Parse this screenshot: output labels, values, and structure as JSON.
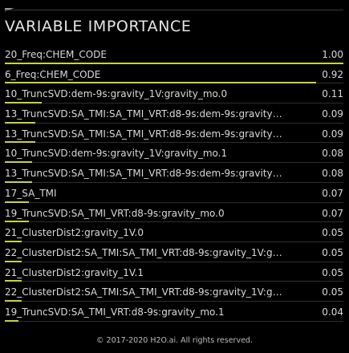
{
  "title": "VARIABLE IMPORTANCE",
  "footer": "© 2017-2020 H2O.ai. All rights reserved.",
  "colors": {
    "background": "#000000",
    "bar": "#c8d43a",
    "text": "#d9d9d9"
  },
  "chart_data": {
    "type": "bar",
    "orientation": "horizontal",
    "title": "VARIABLE IMPORTANCE",
    "xlim": [
      0,
      1
    ],
    "grid": false,
    "categories": [
      "20_Freq:CHEM_CODE",
      "6_Freq:CHEM_CODE",
      "10_TruncSVD:dem-9s:gravity_1V:gravity_mo.0",
      "13_TruncSVD:SA_TMI:SA_TMI_VRT:d8-9s:dem-9s:gravity_1V:...",
      "13_TruncSVD:SA_TMI:SA_TMI_VRT:d8-9s:dem-9s:gravity_1V:...",
      "10_TruncSVD:dem-9s:gravity_1V:gravity_mo.1",
      "13_TruncSVD:SA_TMI:SA_TMI_VRT:d8-9s:dem-9s:gravity_1V:...",
      "17_SA_TMI",
      "19_TruncSVD:SA_TMI_VRT:d8-9s:gravity_mo.0",
      "21_ClusterDist2:gravity_1V.0",
      "22_ClusterDist2:SA_TMI:SA_TMI_VRT:d8-9s:gravity_1V:gravi...",
      "21_ClusterDist2:gravity_1V.1",
      "22_ClusterDist2:SA_TMI:SA_TMI_VRT:d8-9s:gravity_1V:gravi...",
      "19_TruncSVD:SA_TMI_VRT:d8-9s:gravity_mo.1"
    ],
    "value_labels": [
      "1.00",
      "0.92",
      "0.11",
      "0.09",
      "0.09",
      "0.08",
      "0.08",
      "0.07",
      "0.07",
      "0.05",
      "0.05",
      "0.05",
      "0.05",
      "0.04"
    ],
    "values": [
      1.0,
      0.92,
      0.11,
      0.09,
      0.09,
      0.08,
      0.08,
      0.07,
      0.07,
      0.05,
      0.05,
      0.05,
      0.05,
      0.04
    ]
  }
}
